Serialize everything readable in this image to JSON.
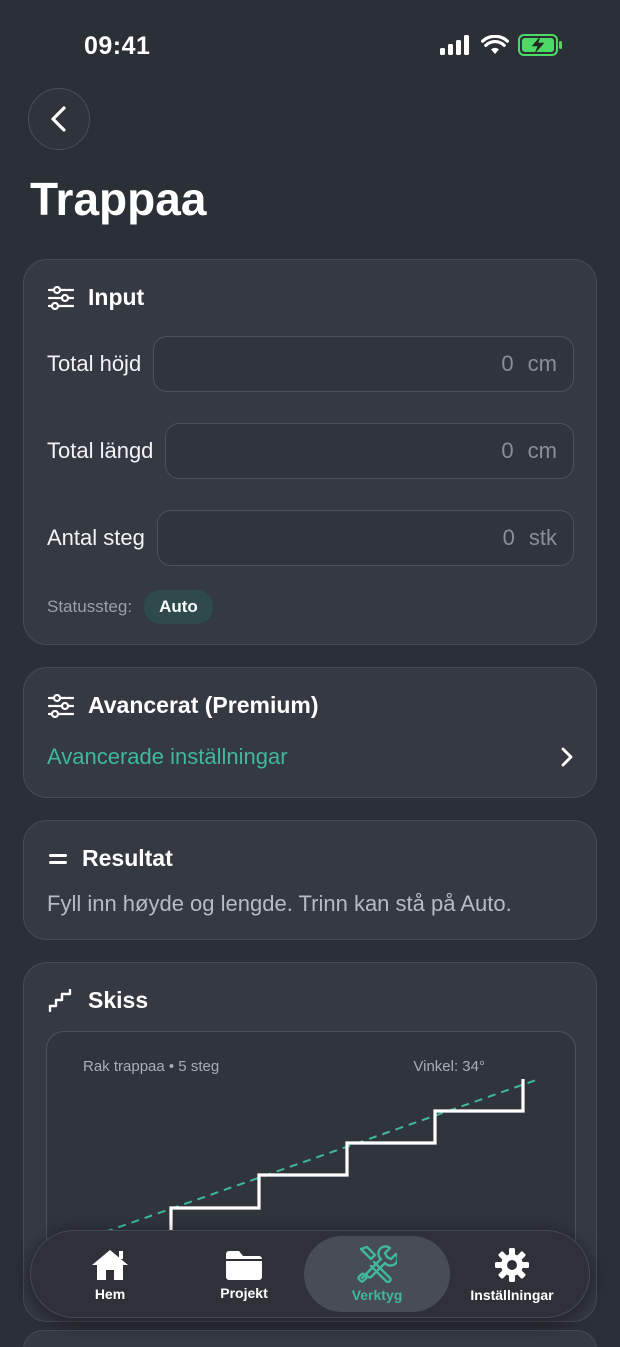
{
  "status_bar": {
    "time": "09:41"
  },
  "header": {
    "title": "Trappaa"
  },
  "input_card": {
    "title": "Input",
    "fields": [
      {
        "label": "Total höjd",
        "value": "0",
        "unit": "cm"
      },
      {
        "label": "Total längd",
        "value": "0",
        "unit": "cm"
      },
      {
        "label": "Antal steg",
        "value": "0",
        "unit": "stk"
      }
    ],
    "status_label": "Statussteg:",
    "status_value": "Auto"
  },
  "advanced_card": {
    "title": "Avancerat (Premium)",
    "link": "Avancerade inställningar"
  },
  "result_card": {
    "title": "Resultat",
    "text": "Fyll inn høyde og lengde. Trinn kan stå på Auto."
  },
  "sketch_card": {
    "title": "Skiss",
    "caption": "Rak trappaa • 5 steg",
    "angle": "Vinkel: 34°"
  },
  "tab_bar": {
    "tabs": [
      {
        "label": "Hem",
        "icon": "house-icon"
      },
      {
        "label": "Projekt",
        "icon": "folder-icon"
      },
      {
        "label": "Verktyg",
        "icon": "tools-icon",
        "active": true
      },
      {
        "label": "Inställningar",
        "icon": "gear-icon"
      }
    ]
  },
  "colors": {
    "accent": "#3fb89c",
    "background": "#2b2f36",
    "card": "#353941",
    "battery": "#4cd964"
  }
}
